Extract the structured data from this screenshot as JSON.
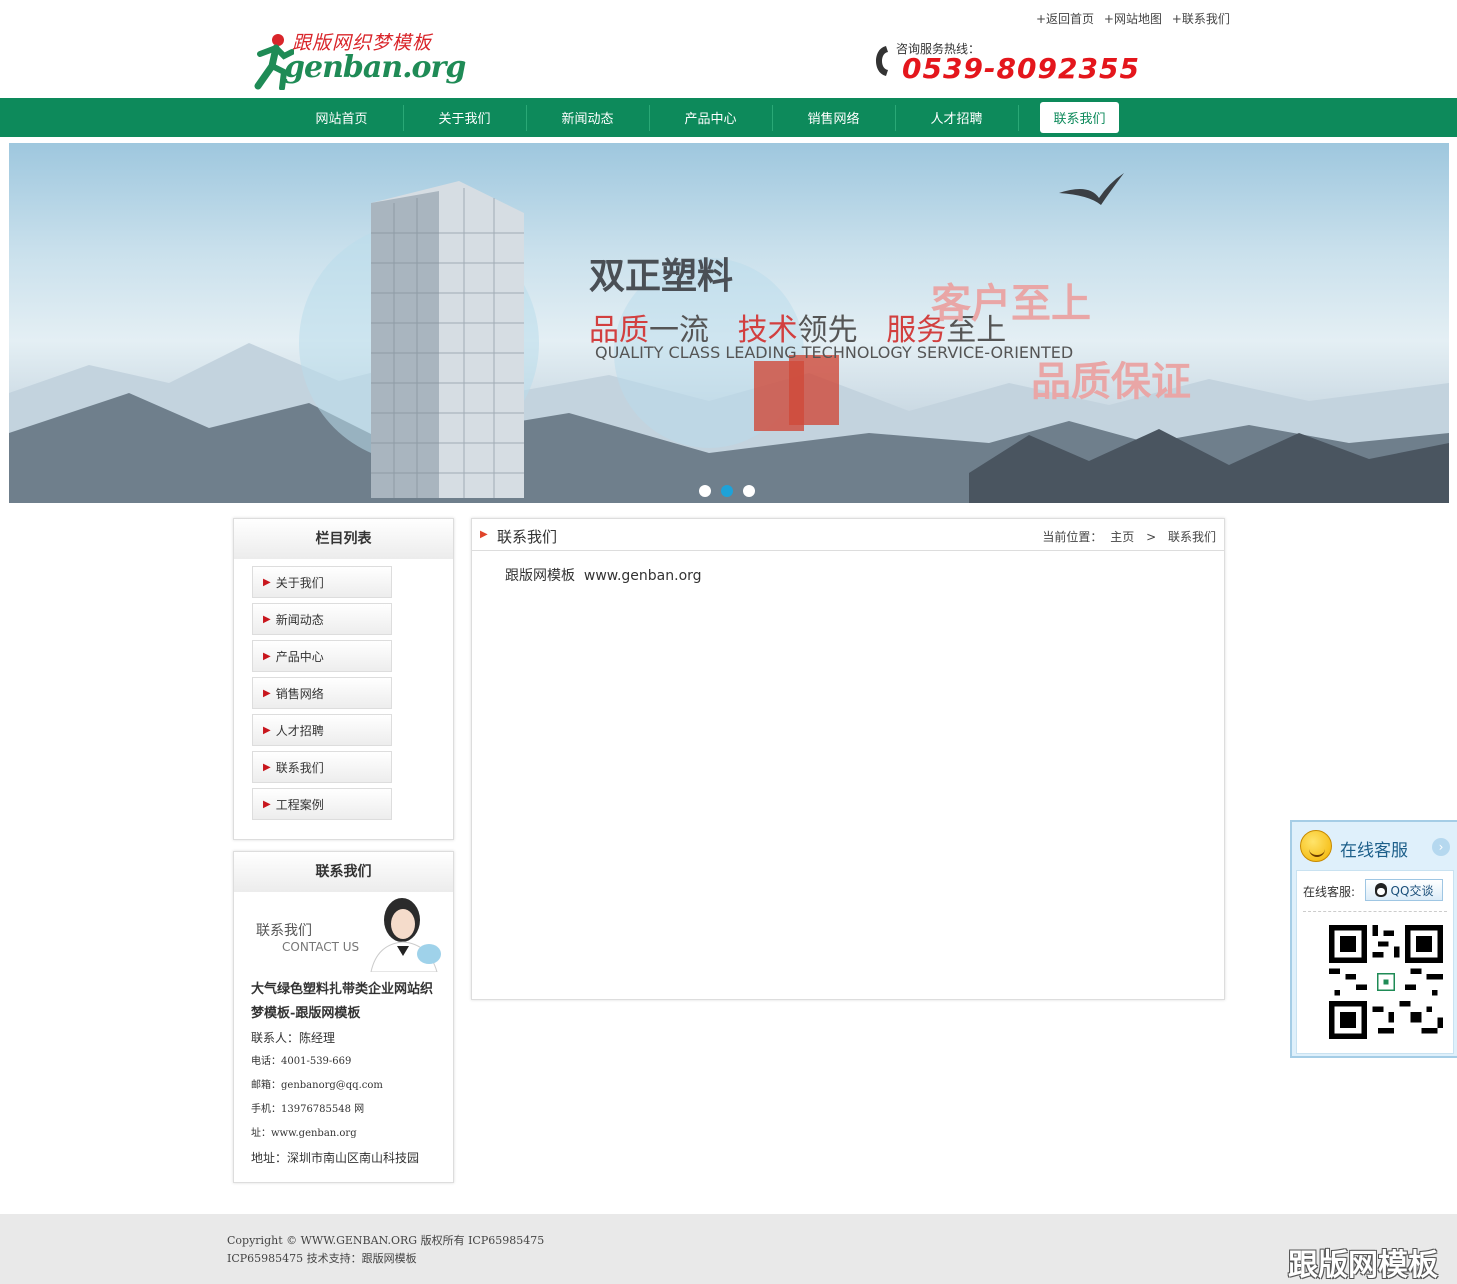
{
  "header": {
    "logo_cn": "跟版网织梦模板",
    "logo_en": "genban.org",
    "top_links": [
      "+返回首页",
      "+网站地图",
      "+联系我们"
    ],
    "hotline_label": "咨询服务热线：",
    "hotline_number": "0539-8092355"
  },
  "nav": {
    "items": [
      "网站首页",
      "关于我们",
      "新闻动态",
      "产品中心",
      "销售网络",
      "人才招聘",
      "联系我们"
    ],
    "active": "联系我们"
  },
  "banner": {
    "title": "双正塑料",
    "slogan_parts": [
      {
        "text": "品质",
        "red": true
      },
      {
        "text": "一流",
        "red": false
      },
      {
        "text": "   技术",
        "red": true
      },
      {
        "text": "领先",
        "red": false
      },
      {
        "text": "   服务",
        "red": true
      },
      {
        "text": "至上",
        "red": false
      }
    ],
    "slogan_en": "QUALITY CLASS LEADING TECHNOLOGY SERVICE-ORIENTED",
    "overlay_1": "客户至上",
    "overlay_2": "品质保证",
    "slide_count": 3,
    "active_slide": 2
  },
  "sidebar": {
    "column_title": "栏目列表",
    "menu": [
      "关于我们",
      "新闻动态",
      "产品中心",
      "销售网络",
      "人才招聘",
      "联系我们",
      "工程案例"
    ],
    "contact_title": "联系我们",
    "contact_img_cn": "联系我们",
    "contact_img_en": "CONTACT US",
    "company": "大气绿色塑料扎带类企业网站织梦模板-跟版网模板",
    "person": "联系人：陈经理",
    "phone": "电话：4001-539-669",
    "email": "邮箱：genbanorg@qq.com",
    "mobile": "手机：13976785548  网",
    "web": "址：www.genban.org",
    "address": "地址：深圳市南山区南山科技园"
  },
  "main": {
    "title": "联系我们",
    "breadcrumb_label": "当前位置：",
    "breadcrumb_home": "主页",
    "breadcrumb_sep": ">",
    "breadcrumb_current": "联系我们",
    "content": "跟版网模板  www.genban.org"
  },
  "kefu": {
    "title": "在线客服",
    "label": "在线客服:",
    "qq_button": "QQ交谈"
  },
  "footer": {
    "line1": "Copyright © WWW.GENBAN.ORG 版权所有 ICP65985475",
    "line2": "ICP65985475 技术支持：跟版网模板",
    "watermark": "跟版网模板"
  },
  "colors": {
    "nav_green": "#0d8a5b",
    "hotline_red": "#e4161c",
    "logo_green": "#1f8b56",
    "logo_red": "#d9252a"
  }
}
